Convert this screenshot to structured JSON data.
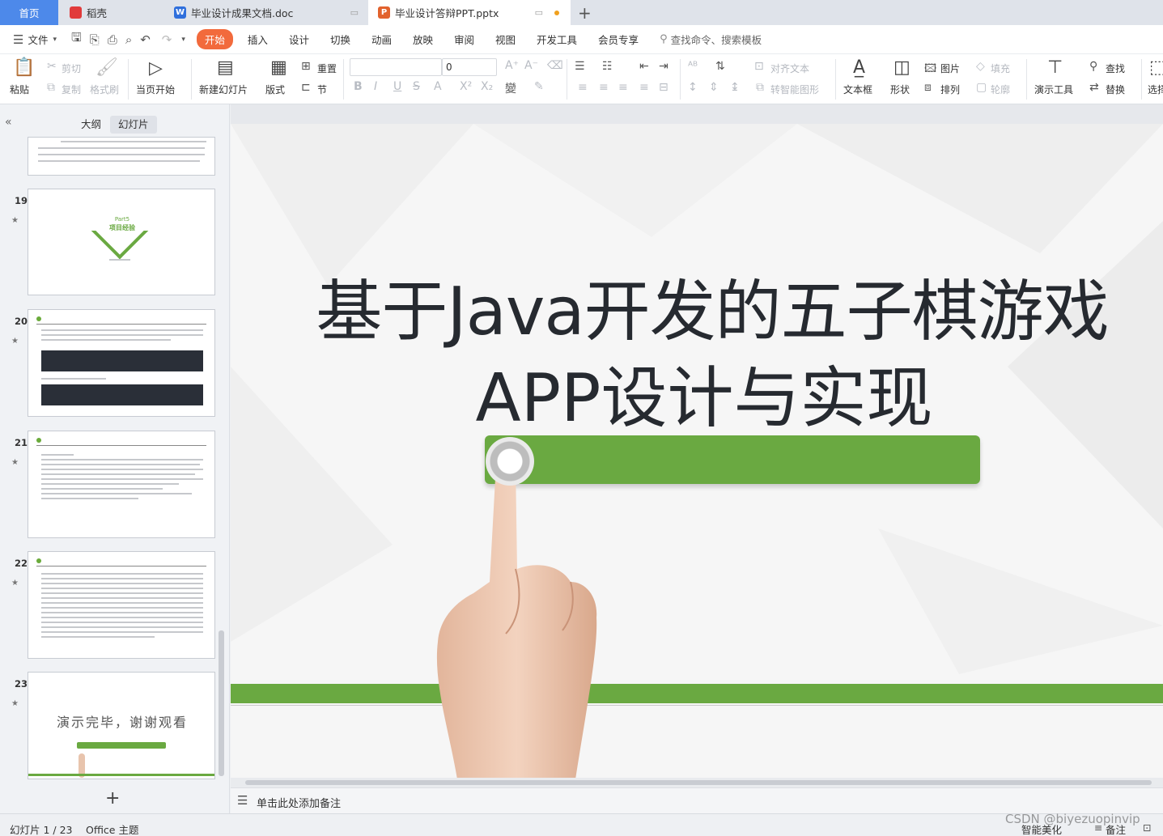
{
  "colors": {
    "accent": "#f26a3c",
    "green": "#6aa941",
    "tab_home": "#4d89ea"
  },
  "tabs": {
    "home": "首页",
    "docer": "稻壳",
    "doc": "毕业设计成果文档.doc",
    "ppt": "毕业设计答辩PPT.pptx"
  },
  "menu": {
    "file": "文件",
    "items": [
      "开始",
      "插入",
      "设计",
      "切换",
      "动画",
      "放映",
      "审阅",
      "视图",
      "开发工具",
      "会员专享"
    ],
    "search": "查找命令、搜索模板"
  },
  "ribbon": {
    "paste": "粘贴",
    "cut": "剪切",
    "copy": "复制",
    "format_painter": "格式刷",
    "from_current": "当页开始",
    "new_slide": "新建幻灯片",
    "layout": "版式",
    "reset": "重置",
    "section": "节",
    "font_size": "0",
    "align_text": "对齐文本",
    "to_smartart": "转智能图形",
    "textbox": "文本框",
    "shape": "形状",
    "picture": "图片",
    "arrange": "排列",
    "fill": "填充",
    "outline": "轮廓",
    "present_tool": "演示工具",
    "find": "查找",
    "replace": "替换",
    "select": "选择"
  },
  "panel": {
    "tab_outline": "大纲",
    "tab_slides": "幻灯片",
    "slides": [
      "19",
      "20",
      "21",
      "22",
      "23"
    ],
    "thumb19_part": "Part5",
    "thumb19_title": "项目经验",
    "thumb23_text": "演示完毕，谢谢观看"
  },
  "slide": {
    "title_line1": "基于Java开发的五子棋游戏",
    "title_line2": "APP设计与实现"
  },
  "notes_placeholder": "单击此处添加备注",
  "status": {
    "slide_info": "幻灯片 1 / 23",
    "theme": "Office 主题",
    "smart_beautify": "智能美化",
    "notes": "备注"
  },
  "watermark": "CSDN @biyezuopinvip"
}
